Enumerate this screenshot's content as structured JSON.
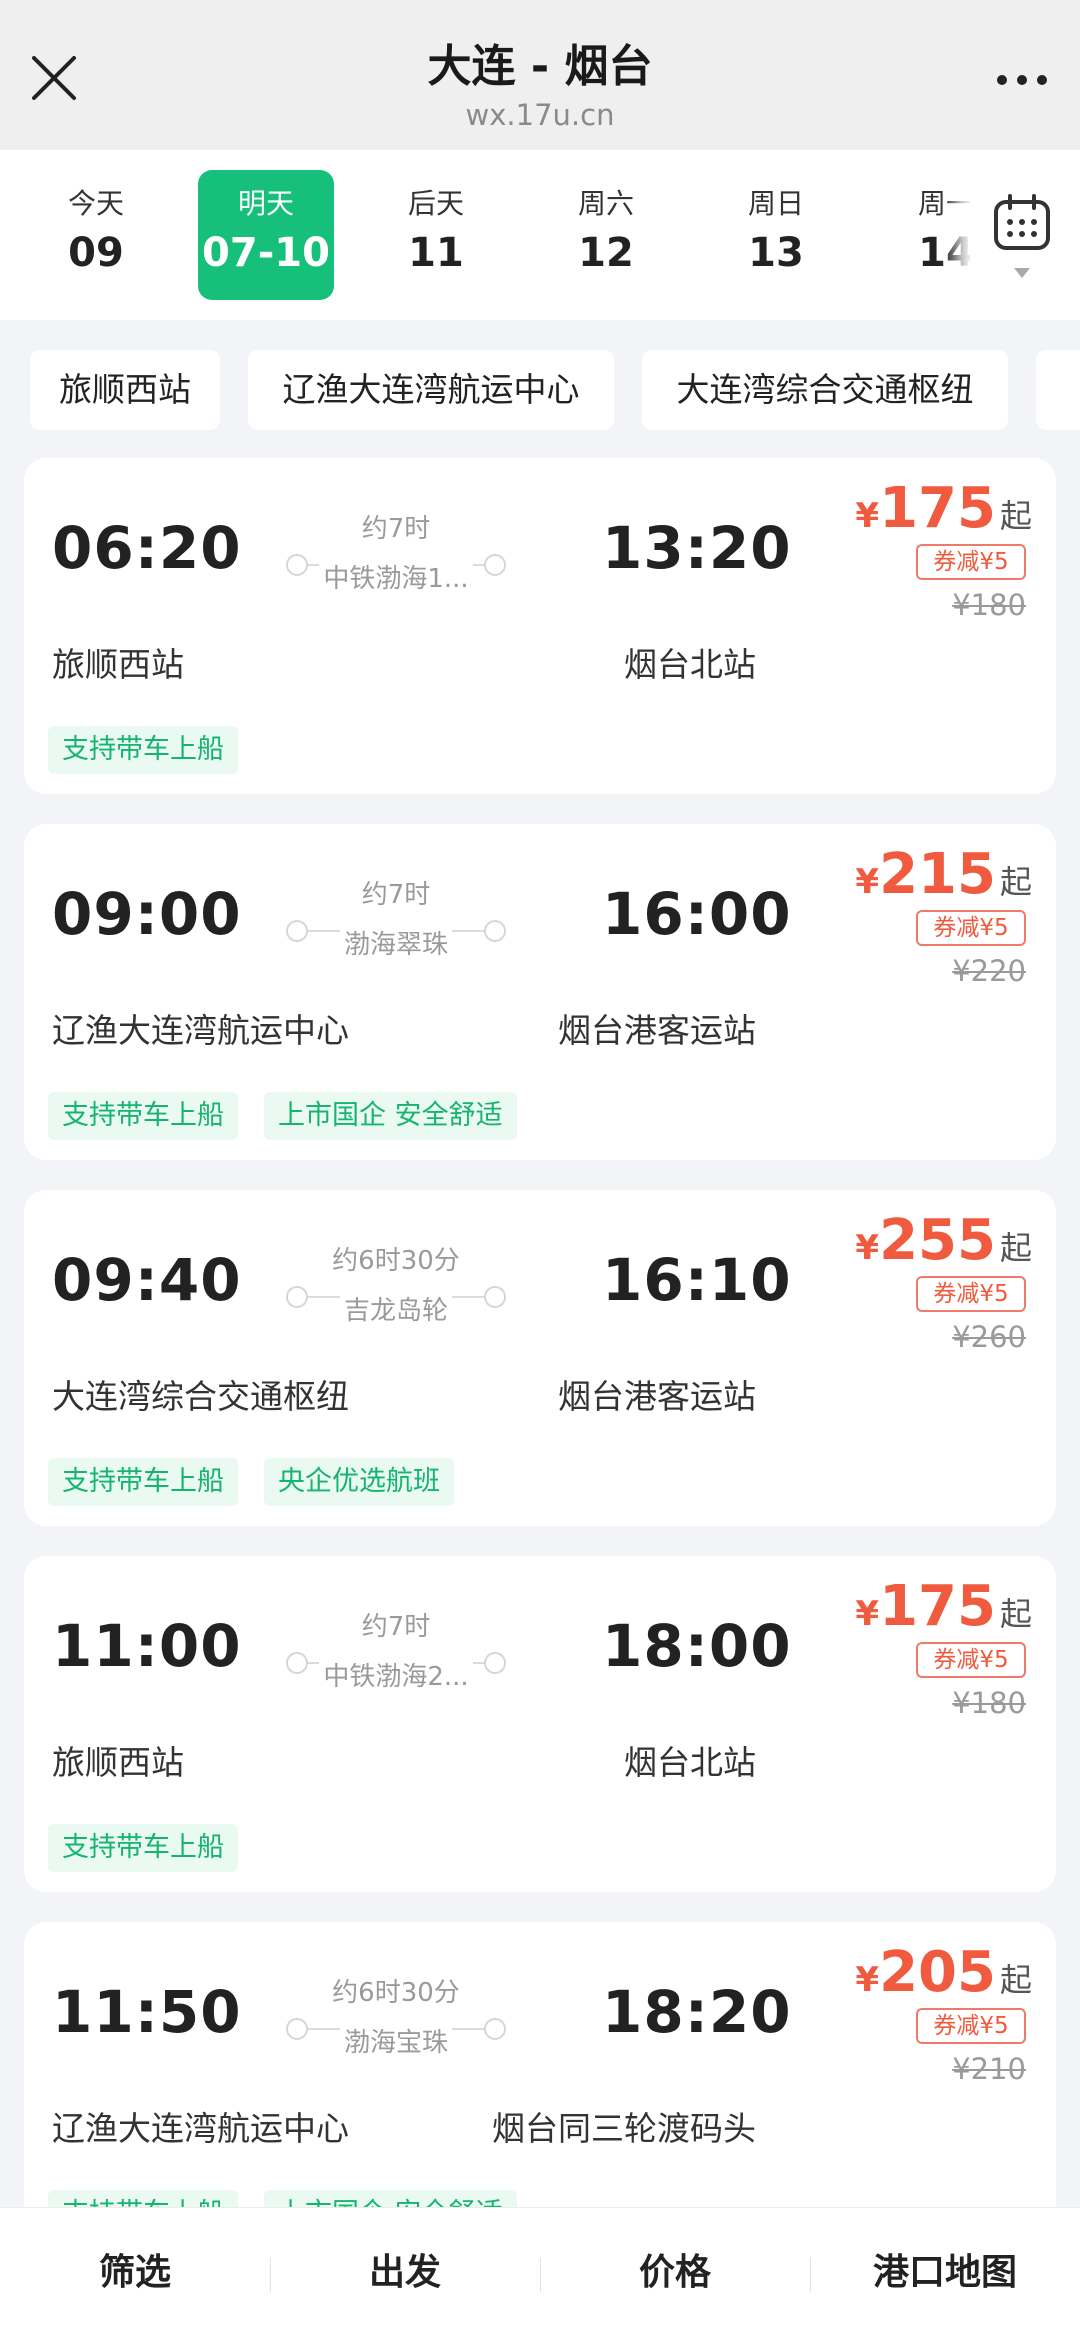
{
  "header": {
    "title": "大连 - 烟台",
    "url": "wx.17u.cn"
  },
  "dates": [
    {
      "label": "今天",
      "num": "09"
    },
    {
      "label": "明天",
      "num": "07-10"
    },
    {
      "label": "后天",
      "num": "11"
    },
    {
      "label": "周六",
      "num": "12"
    },
    {
      "label": "周日",
      "num": "13"
    },
    {
      "label": "周一",
      "num": "14"
    }
  ],
  "selected_date_index": 1,
  "stations": [
    "旅顺西站",
    "辽渔大连湾航运中心",
    "大连湾综合交通枢纽"
  ],
  "trips": [
    {
      "dep_time": "06:20",
      "arr_time": "13:20",
      "duration": "约7时",
      "ship": "中铁渤海1...",
      "dep_station": "旅顺西站",
      "arr_station": "烟台北站",
      "yen": "¥",
      "price": "175",
      "qi": "起",
      "coupon": "券减¥5",
      "orig_price": "¥180",
      "tags": [
        "支持带车上船"
      ]
    },
    {
      "dep_time": "09:00",
      "arr_time": "16:00",
      "duration": "约7时",
      "ship": "渤海翠珠",
      "dep_station": "辽渔大连湾航运中心",
      "arr_station": "烟台港客运站",
      "yen": "¥",
      "price": "215",
      "qi": "起",
      "coupon": "券减¥5",
      "orig_price": "¥220",
      "tags": [
        "支持带车上船",
        "上市国企 安全舒适"
      ]
    },
    {
      "dep_time": "09:40",
      "arr_time": "16:10",
      "duration": "约6时30分",
      "ship": "吉龙岛轮",
      "dep_station": "大连湾综合交通枢纽",
      "arr_station": "烟台港客运站",
      "yen": "¥",
      "price": "255",
      "qi": "起",
      "coupon": "券减¥5",
      "orig_price": "¥260",
      "tags": [
        "支持带车上船",
        "央企优选航班"
      ]
    },
    {
      "dep_time": "11:00",
      "arr_time": "18:00",
      "duration": "约7时",
      "ship": "中铁渤海2...",
      "dep_station": "旅顺西站",
      "arr_station": "烟台北站",
      "yen": "¥",
      "price": "175",
      "qi": "起",
      "coupon": "券减¥5",
      "orig_price": "¥180",
      "tags": [
        "支持带车上船"
      ]
    },
    {
      "dep_time": "11:50",
      "arr_time": "18:20",
      "duration": "约6时30分",
      "ship": "渤海宝珠",
      "dep_station": "辽渔大连湾航运中心",
      "arr_station": "烟台同三轮渡码头",
      "yen": "¥",
      "price": "205",
      "qi": "起",
      "coupon": "券减¥5",
      "orig_price": "¥210",
      "tags": [
        "支持带车上船",
        "上市国企 安全舒适"
      ]
    }
  ],
  "bottom_tabs": [
    "筛选",
    "出发",
    "价格",
    "港口地图"
  ],
  "colors": {
    "accent": "#16c07a",
    "price": "#f05a3e",
    "tag_text": "#15b56f",
    "tag_bg": "#eafaf2"
  }
}
